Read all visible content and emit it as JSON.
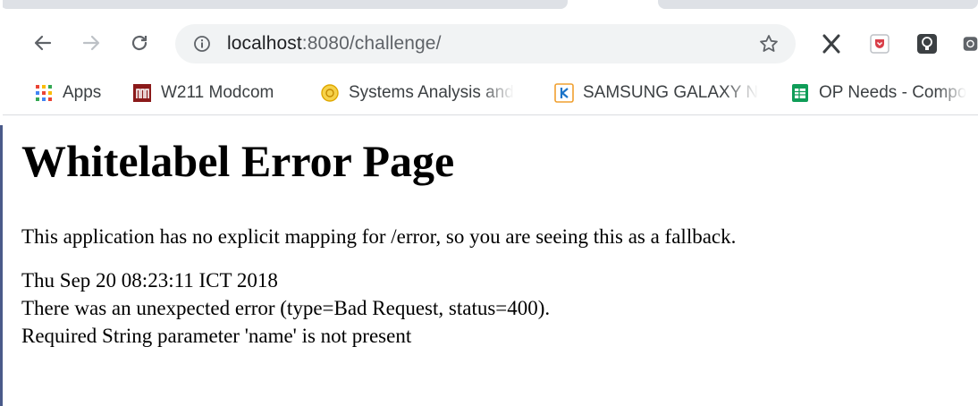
{
  "browser": {
    "url_host": "localhost",
    "url_path": ":8080/challenge/",
    "bookmarks": [
      {
        "label": "Apps",
        "icon": "apps-grid-icon"
      },
      {
        "label": "W211 Modcom",
        "icon": "modcom-icon"
      },
      {
        "label": "Systems Analysis and",
        "icon": "systems-analysis-icon"
      },
      {
        "label": "SAMSUNG GALAXY N",
        "icon": "samsung-k-icon"
      },
      {
        "label": "OP Needs - Compo",
        "icon": "sheets-icon"
      }
    ],
    "extensions": [
      "x-extension-icon",
      "pocket-icon",
      "lightbulb-extension-icon",
      "partial-extension-icon"
    ]
  },
  "page": {
    "title": "Whitelabel Error Page",
    "message": "This application has no explicit mapping for /error, so you are seeing this as a fallback.",
    "timestamp": "Thu Sep 20 08:23:11 ICT 2018",
    "error_line": "There was an unexpected error (type=Bad Request, status=400).",
    "detail_line": "Required String parameter 'name' is not present"
  }
}
